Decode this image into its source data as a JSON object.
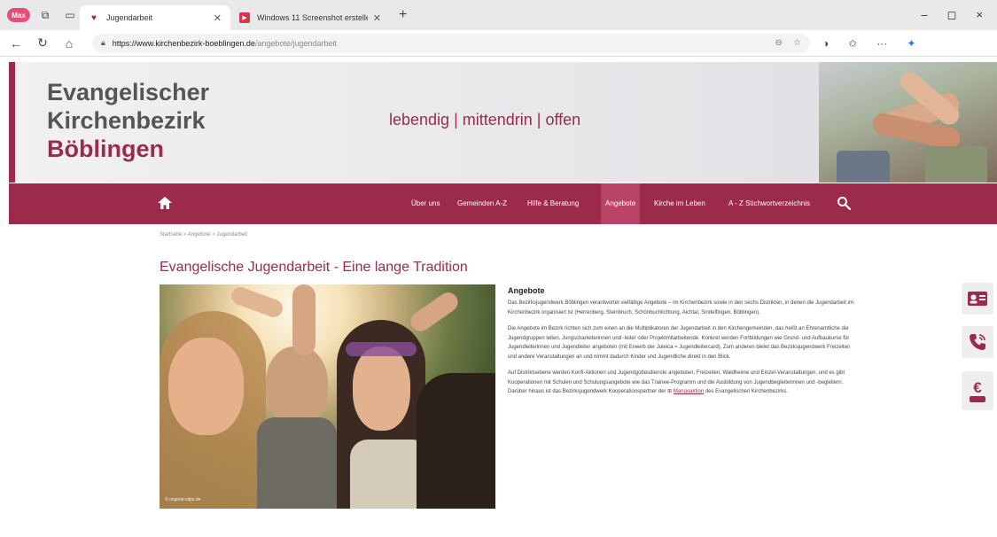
{
  "browser": {
    "profile_label": "Max",
    "tabs": [
      {
        "title": "Jugendarbeit",
        "active": true
      },
      {
        "title": "Windows 11 Screenshot erstellen",
        "active": false
      }
    ],
    "new_tab": "+",
    "window_controls": [
      "–",
      "◻",
      "×"
    ],
    "url_host": "https://www.kirchenbezirk-boeblingen.de",
    "url_path": "/angebote/jugendarbeit"
  },
  "header": {
    "logo_line1": "Evangelischer",
    "logo_line2": "Kirchenbezirk",
    "logo_line3": "Böblingen",
    "slogan": "lebendig | mittendrin | offen"
  },
  "nav": {
    "items": [
      {
        "label": "Über uns",
        "active": false
      },
      {
        "label": "Gemeinden A-Z",
        "active": false
      },
      {
        "label": "Hilfe & Beratung",
        "active": false
      },
      {
        "label": "Angebote",
        "active": true
      },
      {
        "label": "Kirche im Leben",
        "active": false
      },
      {
        "label": "A - Z Stichwortverzeichnis",
        "active": false
      }
    ]
  },
  "breadcrumb": "Startseite > Angebote > Jugendarbeit",
  "content": {
    "title": "Evangelische Jugendarbeit - Eine lange Tradition",
    "image_credit": "© original-cdps.de",
    "section_heading": "Angebote",
    "p1": "Das Bezirksjugendwerk Böblingen verantwortet vielfältige Angebote – im Kirchenbezirk sowie in den sechs Distrikten, in denen die Jugendarbeit im Kirchenbezirk organisiert ist (Herrenberg, Steinbruch, Schönbuchlichtung, Aichtal, Sindelfingen, Böblingen).",
    "p2": "Die Angebote im Bezirk richten sich zum einen an die Multiplikatoren der Jugendarbeit in den Kirchengemeinden, das heißt an Ehrenamtliche die Jugendgruppen leiten, Jungscharleiterinnen und -leiter oder Projektmitarbeitende. Konkret werden Fortbildungen wie Grund- und Aufbaukurse für Jugendleiterinnen und Jugendleiter angeboten (mit Erwerb der Juleica = Jugendleitercard). Zum anderen bietet das Bezirksjugendwerk Freizeiten und andere Veranstaltungen an und nimmt dadurch Kinder und Jugendliche direkt in den Blick.",
    "p3_start": "Auf Distriktsebene werden Konfi-Aktionen und Jugendgottesdienste angeboten, Freizeiten, Waldheime und Einzel-Veranstaltungen, und es gibt Kooperationen mit Schulen und Schulungsangebote wie das Trainee-Programm und die Ausbildung von Jugendbegleiterinnen und -begleitern. Darüber hinaus ist das Bezirksjugendwerk Kooperationspartner der",
    "p3_link": "Mangoaktion",
    "p3_end": "des Evangelischen Kirchenbezirks."
  },
  "side_icons": [
    "contact-card-icon",
    "phone-icon",
    "donate-icon"
  ],
  "colors": {
    "brand": "#9c2a4b",
    "brand_light": "#b94467"
  }
}
